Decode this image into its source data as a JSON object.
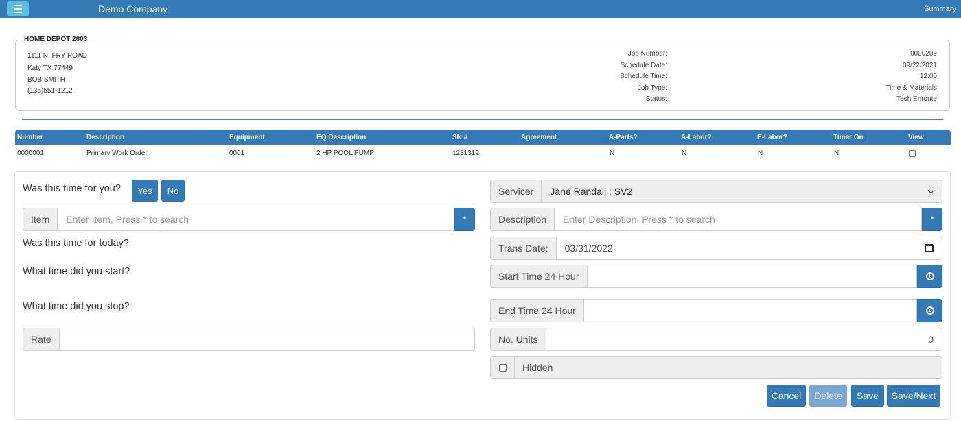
{
  "topbar": {
    "company": "Demo Company",
    "summary": "Summary"
  },
  "customer": {
    "name": "HOME DEPOT 2803",
    "address1": "1111 N. FRY ROAD",
    "address2": "Katy TX 77449",
    "contact": "BOB SMITH",
    "phone": "(135)551-1212"
  },
  "job": {
    "labels": [
      "Job Number:",
      "Schedule Date:",
      "Schedule Time:",
      "Job Type:",
      "Status:"
    ],
    "values": [
      "0000209",
      "09/22/2021",
      "12:00",
      "Time & Materials",
      "Tech Enroute"
    ]
  },
  "table": {
    "headers": [
      "Number",
      "Description",
      "Equipment",
      "EQ Description",
      "SN #",
      "Agreement",
      "A-Parts?",
      "A-Labor?",
      "E-Labor?",
      "Timer On",
      "View"
    ],
    "rows": [
      {
        "number": "0000001",
        "description": "Primary Work Order",
        "equipment": "0001",
        "eq_description": "2 HP POOL PUMP",
        "sn": "1231312",
        "agreement": "",
        "a_parts": "N",
        "a_labor": "N",
        "e_labor": "N",
        "timer_on": "N",
        "view_checked": false
      }
    ]
  },
  "form": {
    "q_time_for_you": "Was this time for you?",
    "yes": "Yes",
    "no": "No",
    "item_label": "Item",
    "item_placeholder": "Enter Item, Press * to search",
    "item_search": "*",
    "q_today": "Was this time for today?",
    "q_start": "What time did you start?",
    "q_stop": "What time did you stop?",
    "rate_label": "Rate",
    "rate_value": "",
    "servicer_label": "Servicer",
    "servicer_value": "Jane Randall : SV2",
    "description_label": "Description",
    "description_placeholder": "Enter Description, Press * to search",
    "description_search": "*",
    "trans_date_label": "Trans Date:",
    "trans_date_value": "03/31/2022",
    "start_time_label": "Start Time 24 Hour",
    "start_time_value": "",
    "end_time_label": "End Time 24 Hour",
    "end_time_value": "",
    "units_label": "No. Units",
    "units_value": "0",
    "hidden_label": "Hidden",
    "hidden_checked": false
  },
  "actions": {
    "cancel": "Cancel",
    "delete": "Delete",
    "save": "Save",
    "save_next": "Save/Next"
  },
  "colors": {
    "primary": "#337ab7",
    "menu_button": "#5bc0de",
    "addon_bg": "#eeeeee"
  },
  "icons": {
    "menu": "hamburger-icon",
    "clock": "clock-icon",
    "calendar": "calendar-icon",
    "select": "chevron-down-icon"
  }
}
